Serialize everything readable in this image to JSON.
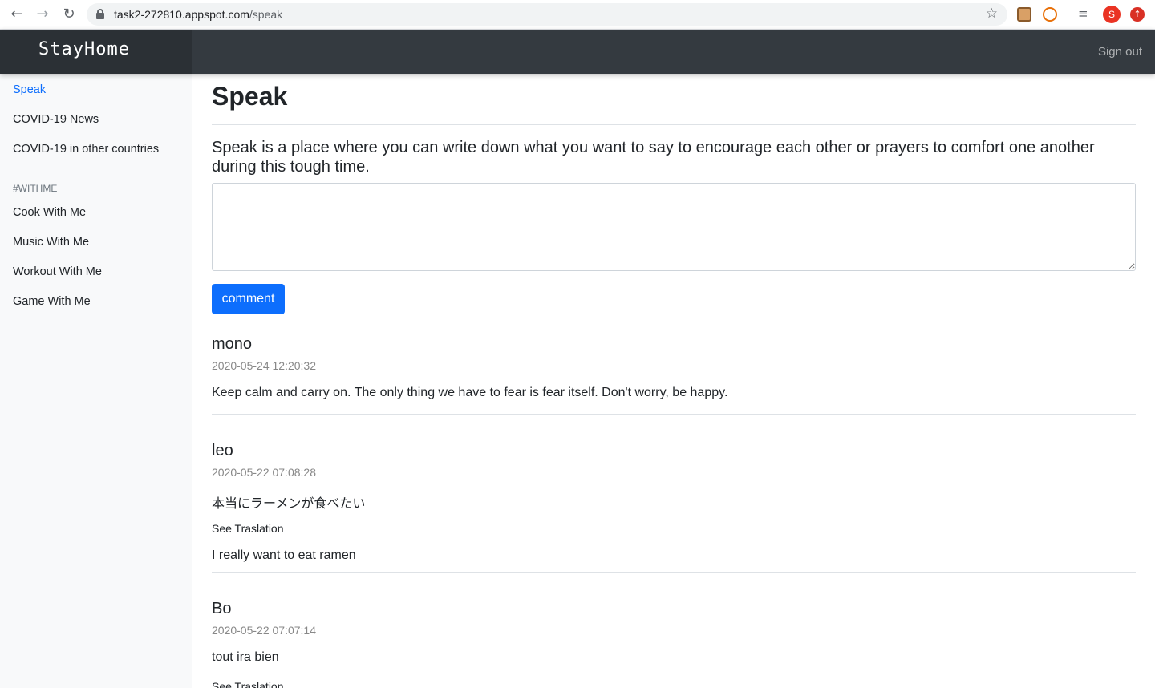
{
  "browser": {
    "url_host": "task2-272810.appspot.com",
    "url_path": "/speak",
    "profile_initial": "S"
  },
  "navbar": {
    "brand": "StayHome",
    "sign_out": "Sign out"
  },
  "sidebar": {
    "items": [
      {
        "label": "Speak",
        "active": true
      },
      {
        "label": "COVID-19 News"
      },
      {
        "label": "COVID-19 in other countries"
      }
    ],
    "section_heading": "#WITHME",
    "withme_items": [
      {
        "label": "Cook With Me"
      },
      {
        "label": "Music With Me"
      },
      {
        "label": "Workout With Me"
      },
      {
        "label": "Game With Me"
      }
    ]
  },
  "main": {
    "title": "Speak",
    "intro": "Speak is a place where you can write down what you want to say to encourage each other or prayers to comfort one another during this tough time.",
    "comment_value": "",
    "comment_button": "comment",
    "posts": [
      {
        "author": "mono",
        "timestamp": "2020-05-24 12:20:32",
        "message": "Keep calm and carry on. The only thing we have to fear is fear itself. Don't worry, be happy."
      },
      {
        "author": "leo",
        "timestamp": "2020-05-22 07:08:28",
        "message": "本当にラーメンが食べたい",
        "see_translation": "See Traslation",
        "translation": "I really want to eat ramen"
      },
      {
        "author": "Bo",
        "timestamp": "2020-05-22 07:07:14",
        "message": "tout ira bien",
        "see_translation": "See Traslation"
      }
    ]
  },
  "colors": {
    "navbar": "#343a40",
    "accent": "#0d6efd",
    "sidebar_bg": "#f8f9fa"
  }
}
